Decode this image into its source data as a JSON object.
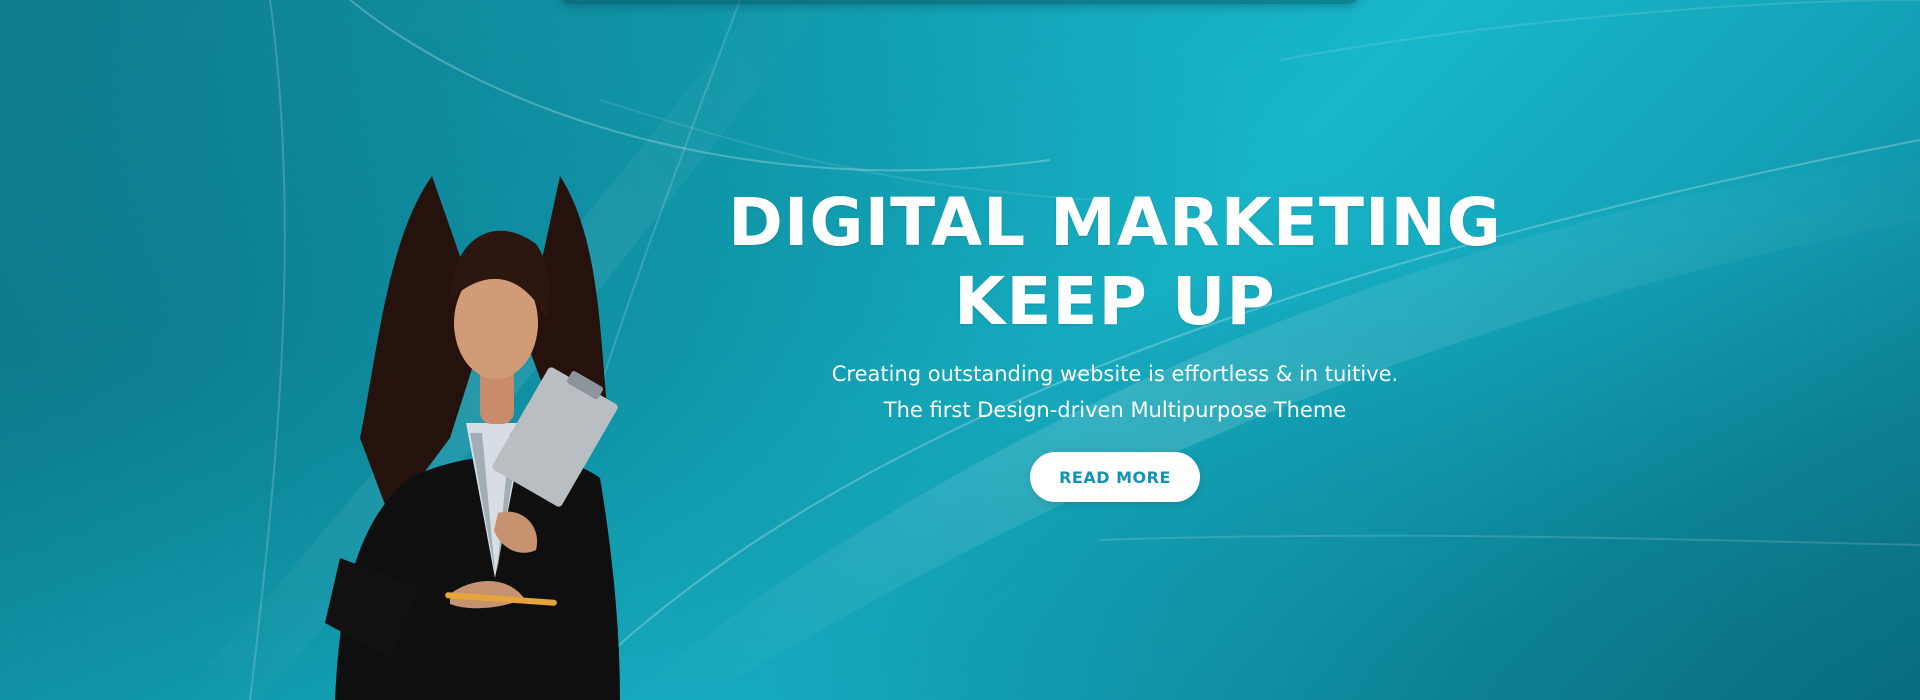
{
  "hero": {
    "headline_line1": "DIGITAL MARKETING",
    "headline_line2": "KEEP UP",
    "subtitle_line1": "Creating outstanding website is effortless & in tuitive.",
    "subtitle_line2": "The first Design-driven Multipurpose Theme",
    "button_label": "READ MORE"
  },
  "colors": {
    "background_dark": "#0c7588",
    "background_light": "#18b7cb",
    "button_text": "#1493b4",
    "text": "#ffffff"
  }
}
